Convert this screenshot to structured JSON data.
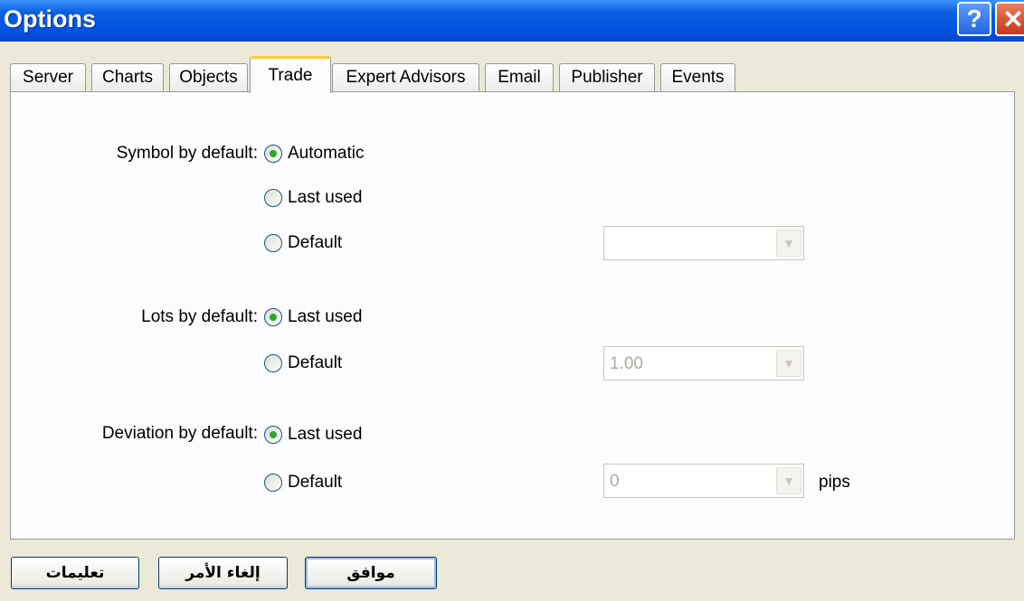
{
  "window": {
    "title": "Options"
  },
  "tabs": [
    {
      "label": "Server"
    },
    {
      "label": "Charts"
    },
    {
      "label": "Objects"
    },
    {
      "label": "Trade"
    },
    {
      "label": "Expert Advisors"
    },
    {
      "label": "Email"
    },
    {
      "label": "Publisher"
    },
    {
      "label": "Events"
    }
  ],
  "active_tab": "Trade",
  "trade": {
    "symbol": {
      "label": "Symbol by default:",
      "options": [
        "Automatic",
        "Last used",
        "Default"
      ],
      "selected": "Automatic",
      "default_value": ""
    },
    "lots": {
      "label": "Lots by default:",
      "options": [
        "Last used",
        "Default"
      ],
      "selected": "Last used",
      "default_value": "1.00"
    },
    "deviation": {
      "label": "Deviation by default:",
      "options": [
        "Last used",
        "Default"
      ],
      "selected": "Last used",
      "default_value": "0",
      "unit": "pips"
    }
  },
  "buttons": {
    "ok": "موافق",
    "cancel": "إلغاء الأمر",
    "help": "تعليمات"
  },
  "colors": {
    "titlebar": "#0055e5",
    "active_tab_accent": "#ffc83c",
    "radio_dot": "#2ea52e"
  }
}
